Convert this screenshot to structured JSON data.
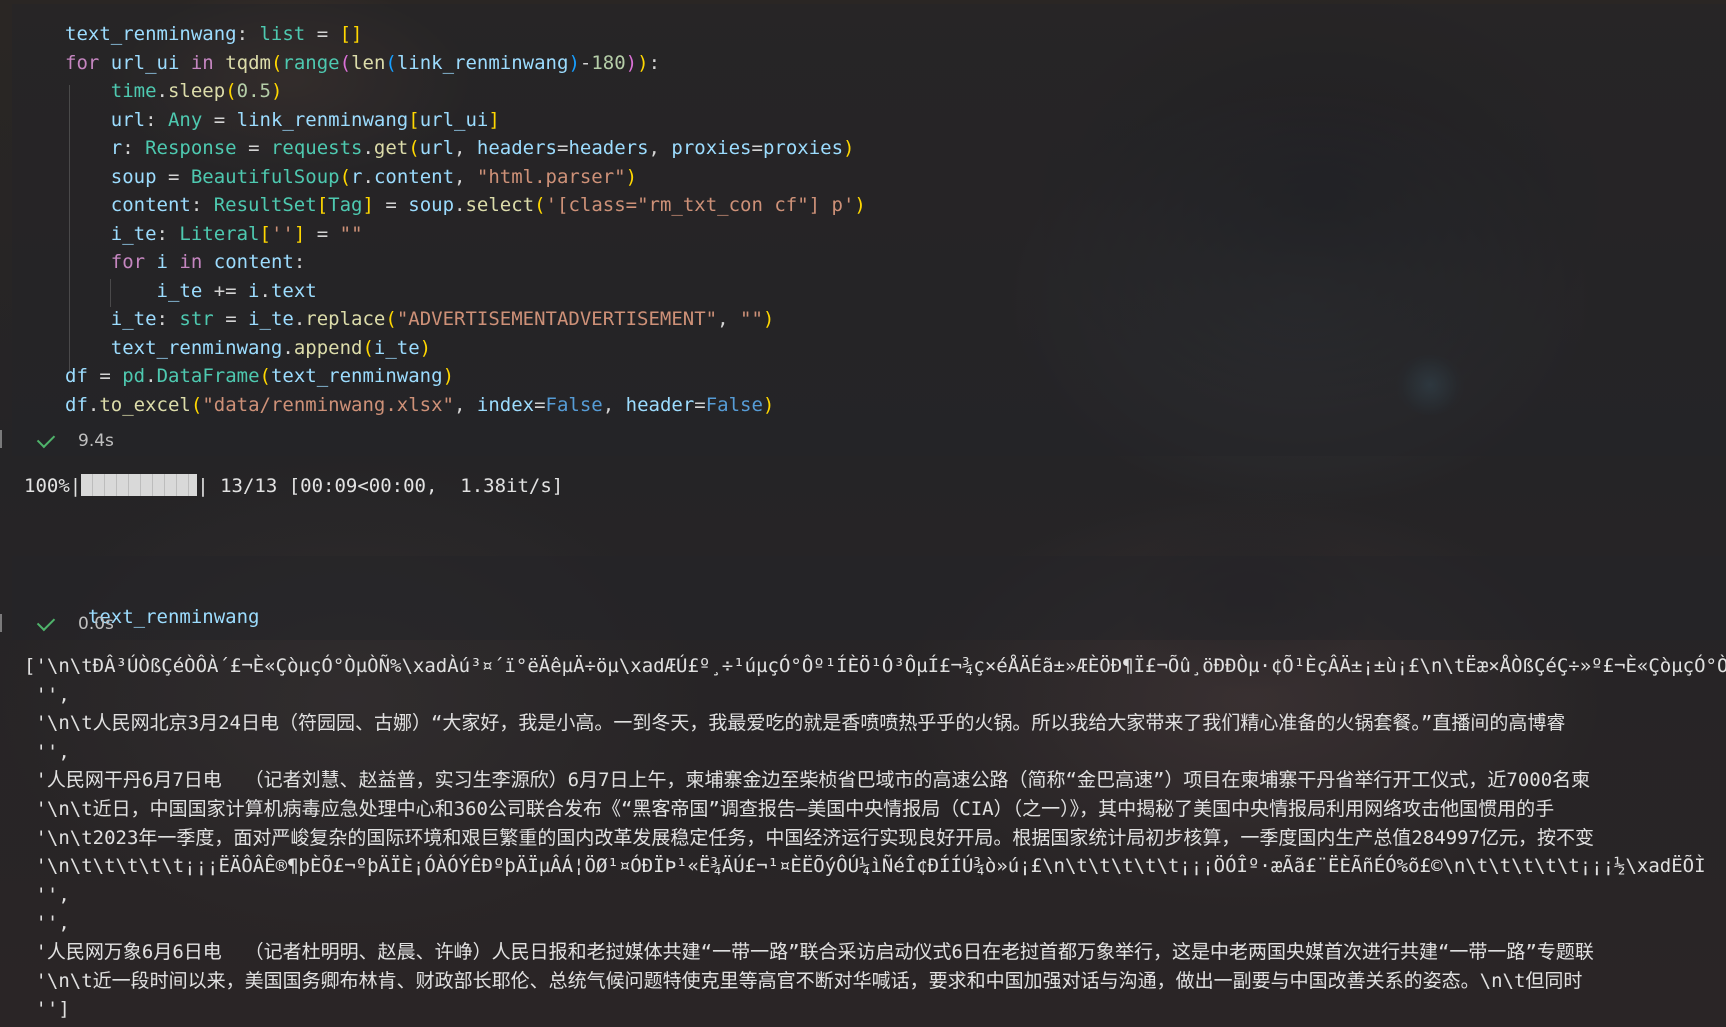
{
  "cell1": {
    "code_lines": [
      [
        {
          "t": "text_renminwang",
          "c": "var"
        },
        {
          "t": ": ",
          "c": "pun"
        },
        {
          "t": "list",
          "c": "typ"
        },
        {
          "t": " = ",
          "c": "pun"
        },
        {
          "t": "[]",
          "c": "brk1"
        }
      ],
      [
        {
          "t": "for",
          "c": "kw"
        },
        {
          "t": " url_ui ",
          "c": "var"
        },
        {
          "t": "in",
          "c": "kw"
        },
        {
          "t": " ",
          "c": "pun"
        },
        {
          "t": "tqdm",
          "c": "fn"
        },
        {
          "t": "(",
          "c": "brk1"
        },
        {
          "t": "range",
          "c": "typ"
        },
        {
          "t": "(",
          "c": "brk2"
        },
        {
          "t": "len",
          "c": "fn"
        },
        {
          "t": "(",
          "c": "brk3"
        },
        {
          "t": "link_renminwang",
          "c": "var"
        },
        {
          "t": ")",
          "c": "brk3"
        },
        {
          "t": "-",
          "c": "pun"
        },
        {
          "t": "180",
          "c": "num"
        },
        {
          "t": ")",
          "c": "brk2"
        },
        {
          "t": ")",
          "c": "brk1"
        },
        {
          "t": ":",
          "c": "pun"
        }
      ],
      [
        {
          "t": "    ",
          "c": "pun"
        },
        {
          "t": "time",
          "c": "typ"
        },
        {
          "t": ".",
          "c": "pun"
        },
        {
          "t": "sleep",
          "c": "fn"
        },
        {
          "t": "(",
          "c": "brk1"
        },
        {
          "t": "0.5",
          "c": "num"
        },
        {
          "t": ")",
          "c": "brk1"
        }
      ],
      [
        {
          "t": "    ",
          "c": "pun"
        },
        {
          "t": "url",
          "c": "var"
        },
        {
          "t": ": ",
          "c": "pun"
        },
        {
          "t": "Any",
          "c": "typ"
        },
        {
          "t": " = ",
          "c": "pun"
        },
        {
          "t": "link_renminwang",
          "c": "var"
        },
        {
          "t": "[",
          "c": "brk1"
        },
        {
          "t": "url_ui",
          "c": "var"
        },
        {
          "t": "]",
          "c": "brk1"
        }
      ],
      [
        {
          "t": "    ",
          "c": "pun"
        },
        {
          "t": "r",
          "c": "var"
        },
        {
          "t": ": ",
          "c": "pun"
        },
        {
          "t": "Response",
          "c": "typ"
        },
        {
          "t": " = ",
          "c": "pun"
        },
        {
          "t": "requests",
          "c": "typ"
        },
        {
          "t": ".",
          "c": "pun"
        },
        {
          "t": "get",
          "c": "fn"
        },
        {
          "t": "(",
          "c": "brk1"
        },
        {
          "t": "url",
          "c": "var"
        },
        {
          "t": ", ",
          "c": "pun"
        },
        {
          "t": "headers",
          "c": "var"
        },
        {
          "t": "=",
          "c": "pun"
        },
        {
          "t": "headers",
          "c": "var"
        },
        {
          "t": ", ",
          "c": "pun"
        },
        {
          "t": "proxies",
          "c": "var"
        },
        {
          "t": "=",
          "c": "pun"
        },
        {
          "t": "proxies",
          "c": "var"
        },
        {
          "t": ")",
          "c": "brk1"
        }
      ],
      [
        {
          "t": "    ",
          "c": "pun"
        },
        {
          "t": "soup",
          "c": "var"
        },
        {
          "t": " = ",
          "c": "pun"
        },
        {
          "t": "BeautifulSoup",
          "c": "typ"
        },
        {
          "t": "(",
          "c": "brk1"
        },
        {
          "t": "r",
          "c": "var"
        },
        {
          "t": ".",
          "c": "pun"
        },
        {
          "t": "content",
          "c": "var"
        },
        {
          "t": ", ",
          "c": "pun"
        },
        {
          "t": "\"html.parser\"",
          "c": "str"
        },
        {
          "t": ")",
          "c": "brk1"
        }
      ],
      [
        {
          "t": "    ",
          "c": "pun"
        },
        {
          "t": "content",
          "c": "var"
        },
        {
          "t": ": ",
          "c": "pun"
        },
        {
          "t": "ResultSet",
          "c": "typ"
        },
        {
          "t": "[",
          "c": "brk1"
        },
        {
          "t": "Tag",
          "c": "typ"
        },
        {
          "t": "]",
          "c": "brk1"
        },
        {
          "t": " = ",
          "c": "pun"
        },
        {
          "t": "soup",
          "c": "var"
        },
        {
          "t": ".",
          "c": "pun"
        },
        {
          "t": "select",
          "c": "fn"
        },
        {
          "t": "(",
          "c": "brk1"
        },
        {
          "t": "'[class=\"rm_txt_con cf\"] p'",
          "c": "str"
        },
        {
          "t": ")",
          "c": "brk1"
        }
      ],
      [
        {
          "t": "    ",
          "c": "pun"
        },
        {
          "t": "i_te",
          "c": "var"
        },
        {
          "t": ": ",
          "c": "pun"
        },
        {
          "t": "Literal",
          "c": "typ"
        },
        {
          "t": "[",
          "c": "brk1"
        },
        {
          "t": "''",
          "c": "str"
        },
        {
          "t": "]",
          "c": "brk1"
        },
        {
          "t": " = ",
          "c": "pun"
        },
        {
          "t": "\"\"",
          "c": "str"
        }
      ],
      [
        {
          "t": "    ",
          "c": "pun"
        },
        {
          "t": "for",
          "c": "kw"
        },
        {
          "t": " i ",
          "c": "var"
        },
        {
          "t": "in",
          "c": "kw"
        },
        {
          "t": " content",
          "c": "var"
        },
        {
          "t": ":",
          "c": "pun"
        }
      ],
      [
        {
          "t": "        ",
          "c": "pun"
        },
        {
          "t": "i_te",
          "c": "var"
        },
        {
          "t": " += ",
          "c": "pun"
        },
        {
          "t": "i",
          "c": "var"
        },
        {
          "t": ".",
          "c": "pun"
        },
        {
          "t": "text",
          "c": "var"
        }
      ],
      [
        {
          "t": "    ",
          "c": "pun"
        },
        {
          "t": "i_te",
          "c": "var"
        },
        {
          "t": ": ",
          "c": "pun"
        },
        {
          "t": "str",
          "c": "typ"
        },
        {
          "t": " = ",
          "c": "pun"
        },
        {
          "t": "i_te",
          "c": "var"
        },
        {
          "t": ".",
          "c": "pun"
        },
        {
          "t": "replace",
          "c": "fn"
        },
        {
          "t": "(",
          "c": "brk1"
        },
        {
          "t": "\"ADVERTISEMENTADVERTISEMENT\"",
          "c": "str"
        },
        {
          "t": ", ",
          "c": "pun"
        },
        {
          "t": "\"\"",
          "c": "str"
        },
        {
          "t": ")",
          "c": "brk1"
        }
      ],
      [
        {
          "t": "    ",
          "c": "pun"
        },
        {
          "t": "text_renminwang",
          "c": "var"
        },
        {
          "t": ".",
          "c": "pun"
        },
        {
          "t": "append",
          "c": "fn"
        },
        {
          "t": "(",
          "c": "brk1"
        },
        {
          "t": "i_te",
          "c": "var"
        },
        {
          "t": ")",
          "c": "brk1"
        }
      ],
      [
        {
          "t": "df",
          "c": "var"
        },
        {
          "t": " = ",
          "c": "pun"
        },
        {
          "t": "pd",
          "c": "typ"
        },
        {
          "t": ".",
          "c": "pun"
        },
        {
          "t": "DataFrame",
          "c": "typ"
        },
        {
          "t": "(",
          "c": "brk1"
        },
        {
          "t": "text_renminwang",
          "c": "var"
        },
        {
          "t": ")",
          "c": "brk1"
        }
      ],
      [
        {
          "t": "df",
          "c": "var"
        },
        {
          "t": ".",
          "c": "pun"
        },
        {
          "t": "to_excel",
          "c": "fn"
        },
        {
          "t": "(",
          "c": "brk1"
        },
        {
          "t": "\"data/renminwang.xlsx\"",
          "c": "str"
        },
        {
          "t": ", ",
          "c": "pun"
        },
        {
          "t": "index",
          "c": "var"
        },
        {
          "t": "=",
          "c": "pun"
        },
        {
          "t": "False",
          "c": "bool"
        },
        {
          "t": ", ",
          "c": "pun"
        },
        {
          "t": "header",
          "c": "var"
        },
        {
          "t": "=",
          "c": "pun"
        },
        {
          "t": "False",
          "c": "bool"
        },
        {
          "t": ")",
          "c": "brk1"
        }
      ]
    ],
    "exec_time": "9.4s",
    "progress": {
      "percent_label": "100%|",
      "fill_fraction": 1.0,
      "after_bar": "| 13/13 [00:09<00:00,  1.38it/s]"
    }
  },
  "cell2": {
    "code": "text_renminwang",
    "exec_time": "0.0s"
  },
  "output_lines": [
    "['\\n\\tÐÂ³ÚÒßÇéÒÔÀ´£¬È«ÇòµçÓ°ÒµÒÑ%\\xadÀú³¤´ï°ëÄêµÄ÷öµ\\xadÆÚ£º¸÷¹úµçÓ°Ôº¹ÍÈÖ¹Ó³ÔµÍ£¬¾ç×éÅÄÉã±»ÆÈÖÐ¶Ï£¬Õû¸öÐÐÒµ·¢Õ¹ÈçÂÄ±¡±ù¡£\\n\\tËæ×ÅÒßÇéÇ÷»º£¬È«ÇòµçÓ°Ò",
    " '',",
    " '\\n\\t人民网北京3月24日电（符园园、古娜）“大家好，我是小高。一到冬天，我最爱吃的就是香喷喷热乎乎的火锅。所以我给大家带来了我们精心准备的火锅套餐。”直播间的高博睿",
    " '',",
    " '人民网干丹6月7日电  （记者刘慧、赵益普，实习生李源欣）6月7日上午，柬埔寨金边至柴桢省巴域市的高速公路（简称“金巴高速”）项目在柬埔寨干丹省举行开工仪式，近7000名柬",
    " '\\n\\t近日，中国国家计算机病毒应急处理中心和360公司联合发布《“黑客帝国”调查报告—美国中央情报局（CIA）（之一）》，其中揭秘了美国中央情报局利用网络攻击他国惯用的手",
    " '\\n\\t2023年一季度，面对严峻复杂的国际环境和艰巨繁重的国内改革发展稳定任务，中国经济运行实现良好开局。根据国家统计局初步核算，一季度国内生产总值284997亿元，按不变",
    " '\\n\\t\\t\\t\\t\\t¡¡¡ËÄÔÂÊ®¶þÈÕ£¬ºþÄÏÈ¡ÓÀÓÝÊÐºþÄÏµÂÁ¦ÖØ¹¤ÓÐÏÞ¹«Ë¾ÄÚ£¬¹¤ÈËÕýÔÚ¼ìÑéÎ¢ÐÍÍÚ¾ò»ú¡£\\n\\t\\t\\t\\t\\t¡¡¡ÖÓÎº·æÃã£¨ËÈÃñÉÓ%õ£©\\n\\t\\t\\t\\t\\t¡¡¡½\\xadËÕÌ",
    " '',",
    " '',",
    " '人民网万象6月6日电  （记者杜明明、赵晨、许峥）人民日报和老挝媒体共建“一带一路”联合采访启动仪式6日在老挝首都万象举行，这是中老两国央媒首次进行共建“一带一路”专题联",
    " '\\n\\t近一段时间以来，美国国务卿布林肯、财政部长耶伦、总统气候问题特使克里等高官不断对华喊话，要求和中国加强对话与沟通，做出一副要与中国改善关系的姿态。\\n\\t但同时",
    " '']"
  ],
  "colors": {
    "keyword": "#c586c0",
    "function": "#dcdcaa",
    "variable": "#9cdcfe",
    "type": "#4ec9b0",
    "string": "#ce9178",
    "number": "#b5cea8",
    "boolean": "#569cd6",
    "success_check": "#4fb36b"
  },
  "icons": {
    "success": "check-icon"
  }
}
